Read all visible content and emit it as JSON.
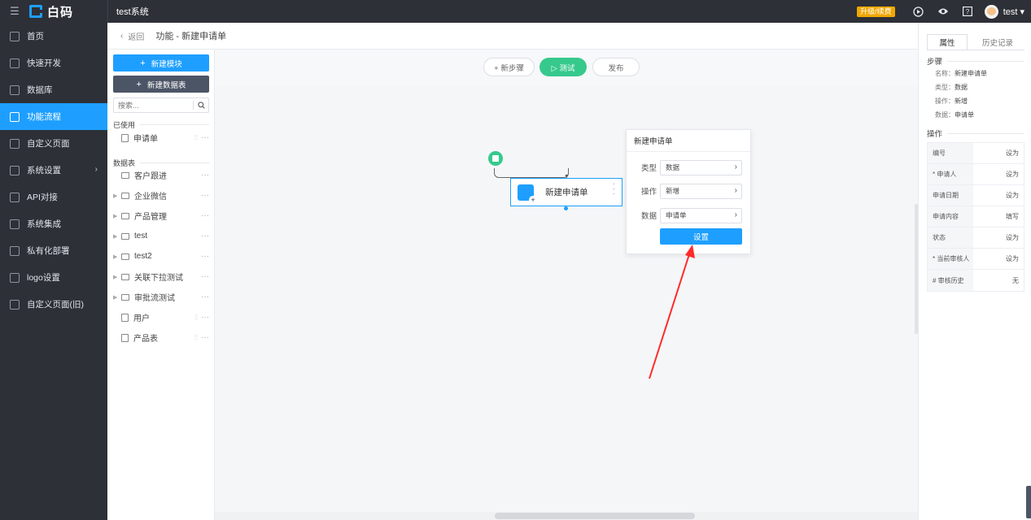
{
  "topbar": {
    "brand": "白码",
    "system_name": "test系统",
    "upgrade_badge": "升级/续费",
    "user_name": "test"
  },
  "sidebar": {
    "items": [
      {
        "label": "首页",
        "active": false
      },
      {
        "label": "快速开发",
        "active": false
      },
      {
        "label": "数据库",
        "active": false
      },
      {
        "label": "功能流程",
        "active": true
      },
      {
        "label": "自定义页面",
        "active": false
      },
      {
        "label": "系统设置",
        "active": false
      },
      {
        "label": "API对接",
        "active": false
      },
      {
        "label": "系统集成",
        "active": false
      },
      {
        "label": "私有化部署",
        "active": false
      },
      {
        "label": "logo设置",
        "active": false
      },
      {
        "label": "自定义页面(旧)",
        "active": false
      }
    ]
  },
  "header": {
    "back_label": "返回",
    "page_title": "功能 - 新建申请单"
  },
  "modules": {
    "new_module_label": "新建模块",
    "new_table_label": "新建数据表",
    "search_placeholder": "搜索...",
    "used_group": "已使用",
    "used_items": [
      {
        "label": "申请单"
      }
    ],
    "tables_group": "数据表",
    "tables": [
      {
        "label": "客户跟进",
        "type": "folder",
        "expandable": false
      },
      {
        "label": "企业微信",
        "type": "folder",
        "expandable": true
      },
      {
        "label": "产品管理",
        "type": "folder",
        "expandable": true
      },
      {
        "label": "test",
        "type": "folder",
        "expandable": true
      },
      {
        "label": "test2",
        "type": "folder",
        "expandable": true
      },
      {
        "label": "关联下拉测试",
        "type": "folder",
        "expandable": true
      },
      {
        "label": "审批流测试",
        "type": "folder",
        "expandable": true
      },
      {
        "label": "用户",
        "type": "table",
        "expandable": false
      },
      {
        "label": "产品表",
        "type": "table",
        "expandable": false
      }
    ]
  },
  "canvas": {
    "new_step_label": "+ 新步骤",
    "test_label": "▷ 测试",
    "publish_label": "发布",
    "node_label": "新建申请单"
  },
  "popup": {
    "title": "新建申请单",
    "rows": [
      {
        "label": "类型",
        "value": "数据"
      },
      {
        "label": "操作",
        "value": "新增"
      },
      {
        "label": "数据",
        "value": "申请单"
      }
    ],
    "set_button": "设置"
  },
  "rightpanel": {
    "tab_properties": "属性",
    "tab_history": "历史记录",
    "step_section": "步骤",
    "step_props": [
      {
        "key": "名称：",
        "value": "新建申请单"
      },
      {
        "key": "类型：",
        "value": "数据"
      },
      {
        "key": "操作：",
        "value": "新增"
      },
      {
        "key": "数据：",
        "value": "申请单"
      }
    ],
    "ops_section": "操作",
    "ops": [
      {
        "name": "编号",
        "action": "设为"
      },
      {
        "name": "* 申请人",
        "action": "设为"
      },
      {
        "name": "申请日期",
        "action": "设为"
      },
      {
        "name": "申请内容",
        "action": "填写"
      },
      {
        "name": "状态",
        "action": "设为"
      },
      {
        "name": "* 当前审核人",
        "action": "设为"
      },
      {
        "name": "# 审核历史",
        "action": "无"
      }
    ]
  },
  "colors": {
    "accent": "#1e9fff",
    "nav_bg": "#2d3037",
    "success": "#36c98c",
    "annotation": "#ff2a2a"
  }
}
